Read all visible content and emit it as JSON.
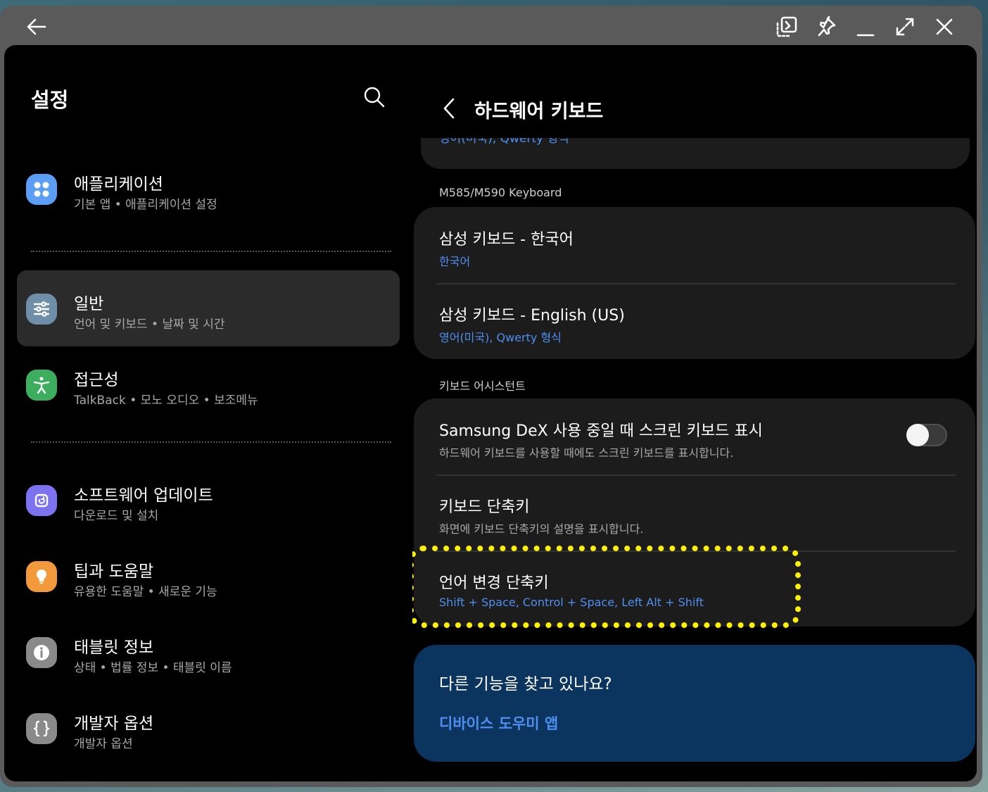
{
  "colors": {
    "accent_blue": "#4e8fef",
    "highlight_yellow": "#fff200",
    "help_card_bg": "#0b345e",
    "selected_bg": "#2b2b2b"
  },
  "titlebar": {
    "icons": [
      "back-arrow-icon",
      "screenshot-icon",
      "pin-icon",
      "minimize-icon",
      "maximize-icon",
      "close-icon"
    ]
  },
  "left": {
    "title": "설정",
    "menu": [
      {
        "title": "애플리케이션",
        "sub": "기본 앱  •  애플리케이션 설정",
        "icon": "apps-icon",
        "icon_color": "#5b9ef5"
      },
      {
        "title": "일반",
        "sub": "언어 및 키보드  •  날짜 및 시간",
        "icon": "sliders-icon",
        "icon_color": "#6f8fa8"
      },
      {
        "title": "접근성",
        "sub": "TalkBack  •  모노 오디오  •  보조메뉴",
        "icon": "accessibility-icon",
        "icon_color": "#3cae5e"
      },
      {
        "title": "소프트웨어 업데이트",
        "sub": "다운로드 및 설치",
        "icon": "update-icon",
        "icon_color": "#7d72f0"
      },
      {
        "title": "팁과 도움말",
        "sub": "유용한 도움말  •  새로운 기능",
        "icon": "lightbulb-icon",
        "icon_color": "#f29a3b"
      },
      {
        "title": "태블릿 정보",
        "sub": "상태  •  법률 정보  •  태블릿 이름",
        "icon": "info-icon",
        "icon_color": "#8a8a8a"
      },
      {
        "title": "개발자 옵션",
        "sub": "개발자 옵션",
        "icon": "braces-icon",
        "icon_color": "#8a8a8a"
      }
    ]
  },
  "right": {
    "title": "하드웨어 키보드",
    "cut_text": "영어(미국), Qwerty 형식",
    "section1_label": "M585/M590 Keyboard",
    "kb_korean_title": "삼성 키보드 - 한국어",
    "kb_korean_sub": "한국어",
    "kb_english_title": "삼성 키보드 - English (US)",
    "kb_english_sub": "영어(미국), Qwerty 형식",
    "section2_label": "키보드 어시스턴트",
    "dex_title": "Samsung DeX 사용 중일 때 스크린 키보드 표시",
    "dex_sub": "하드웨어 키보드를 사용할 때에도 스크린 키보드를 표시합니다.",
    "dex_toggle_on": false,
    "shortcut_title": "키보드 단축키",
    "shortcut_sub": "화면에 키보드 단축키의 설명을 표시합니다.",
    "lang_title": "언어 변경 단축키",
    "lang_sub": "Shift + Space, Control + Space, Left Alt + Shift",
    "help_title": "다른 기능을 찾고 있나요?",
    "help_link": "디바이스 도우미 앱"
  }
}
